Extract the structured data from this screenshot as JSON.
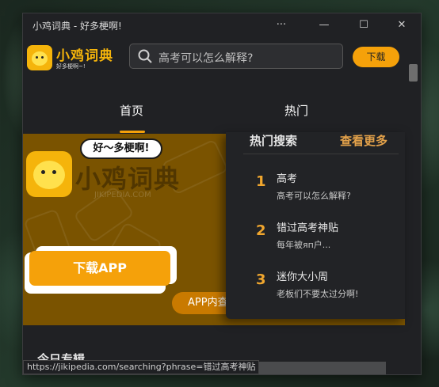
{
  "window": {
    "title": "小鸡词典 - 好多梗啊!"
  },
  "titlebar": {
    "more": "···",
    "minimize": "—",
    "maximize": "☐",
    "close": "✕"
  },
  "header": {
    "brand": "小鸡词典",
    "tagline": "好多梗啊~!",
    "search_placeholder": "高考可以怎么解释?",
    "download_label": "下载"
  },
  "tabs": [
    {
      "label": "首页",
      "active": true
    },
    {
      "label": "热门",
      "active": false
    }
  ],
  "banner": {
    "speech": "好～多梗啊!",
    "brand": "小鸡词典",
    "site": "JIKIPEDIA.COM",
    "download_app": "下载APP",
    "app_pill": "APP内查"
  },
  "hot_search": {
    "title": "热门搜索",
    "more": "查看更多",
    "items": [
      {
        "rank": "1",
        "word": "高考",
        "desc": "高考可以怎么解释?"
      },
      {
        "rank": "2",
        "word": "错过高考神贴",
        "desc": "每年被яп户..."
      },
      {
        "rank": "3",
        "word": "迷你大小周",
        "desc": "老板们不要太过分啊!"
      }
    ]
  },
  "section": {
    "title": "今日专辑"
  },
  "status_url": "https://jikipedia.com/searching?phrase=错过高考神贴",
  "colors": {
    "accent": "#f5a10a",
    "rank": "#f0a62e",
    "more": "#e3a14a",
    "banner": "#7a5300"
  }
}
